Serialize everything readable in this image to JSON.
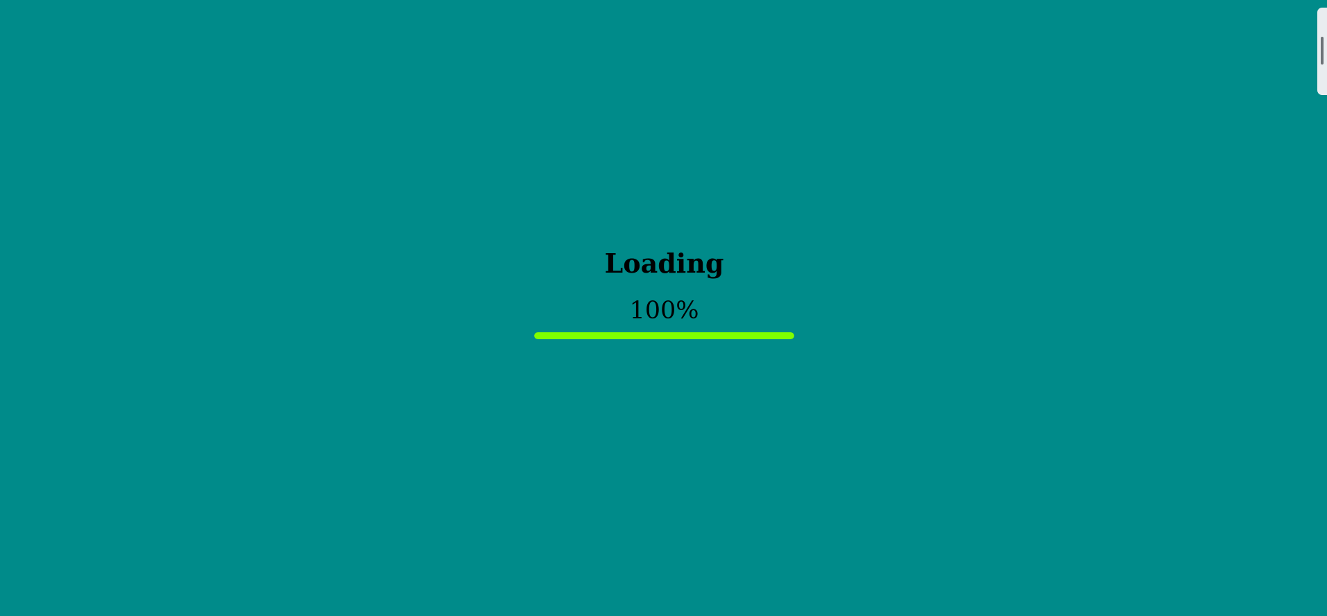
{
  "loader": {
    "title": "Loading",
    "percent_label": "100%",
    "progress_fraction": 1.0
  },
  "colors": {
    "background": "#008b8a",
    "progress": "#7fff00",
    "text": "#000000"
  }
}
